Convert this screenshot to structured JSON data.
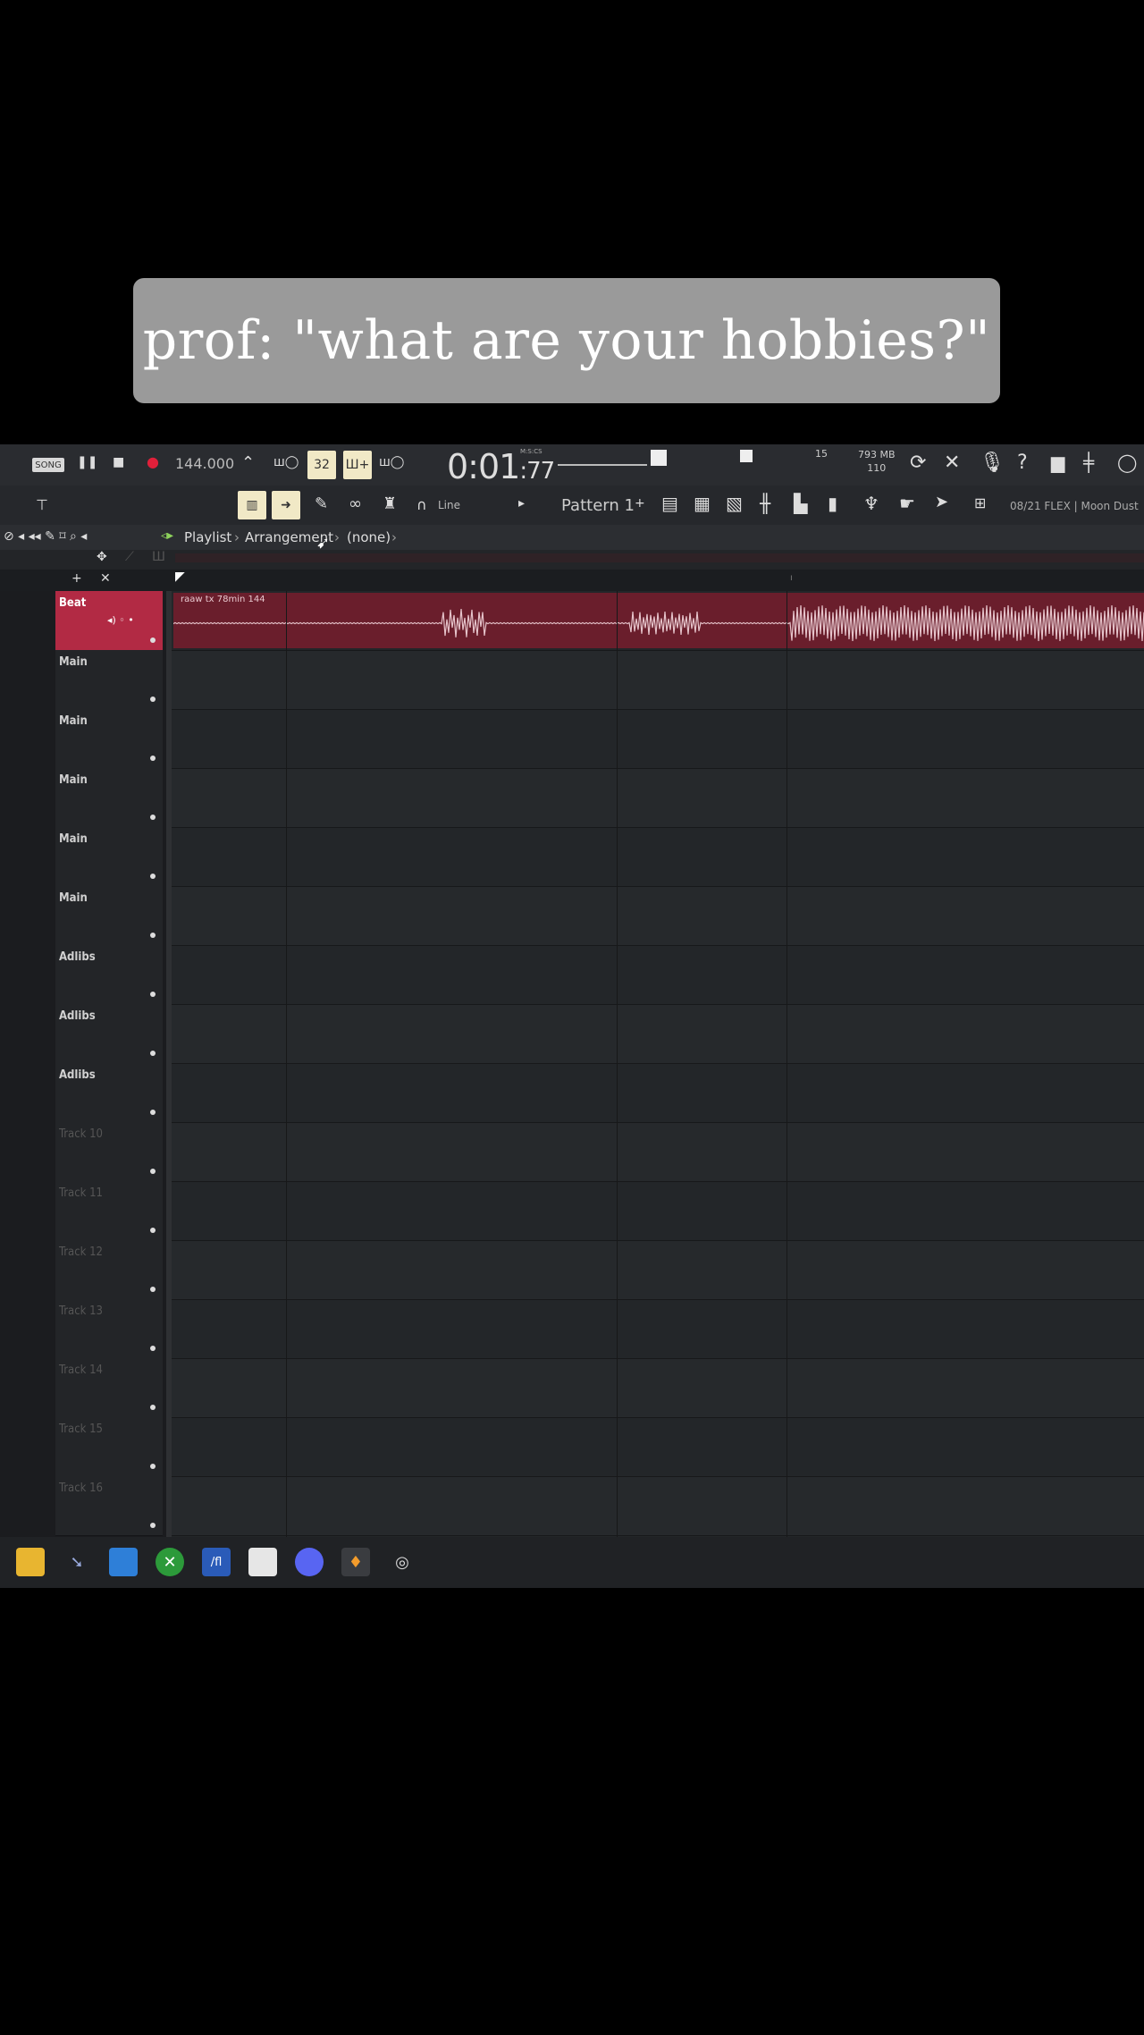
{
  "caption": "prof: \"what are your hobbies?\"",
  "toolbar": {
    "song_mode": "SONG",
    "tempo": "144.000",
    "pattern_step": "32",
    "time_main": "0:01",
    "time_frac": ":77",
    "time_unit": "M:S:CS",
    "cpu_mem": "793 MB",
    "polyphony": "110",
    "cpu_small": "15",
    "snap": "Line",
    "pattern": "Pattern 1",
    "hint": "08/21 FLEX | Moon Dust"
  },
  "playlist": {
    "title": "Playlist",
    "breadcrumb_1": "Arrangement",
    "breadcrumb_2": "(none)"
  },
  "clip": {
    "label": "raaw tx 78min 144"
  },
  "tracks": [
    {
      "name": "Beat"
    },
    {
      "name": "Main"
    },
    {
      "name": "Main"
    },
    {
      "name": "Main"
    },
    {
      "name": "Main"
    },
    {
      "name": "Main"
    },
    {
      "name": "Adlibs"
    },
    {
      "name": "Adlibs"
    },
    {
      "name": "Adlibs"
    },
    {
      "name": "Track 10"
    },
    {
      "name": "Track 11"
    },
    {
      "name": "Track 12"
    },
    {
      "name": "Track 13"
    },
    {
      "name": "Track 14"
    },
    {
      "name": "Track 15"
    },
    {
      "name": "Track 16"
    }
  ],
  "colors": {
    "beat_track": "#b22a44",
    "clip": "#6a1e2c",
    "accent": "#f1e9c6"
  },
  "taskbar_icons": [
    "file-explorer-icon",
    "steam-icon",
    "photos-icon",
    "xbox-icon",
    "fl-studio-alt-icon",
    "store-icon",
    "discord-icon",
    "fl-studio-icon",
    "chrome-icon"
  ]
}
